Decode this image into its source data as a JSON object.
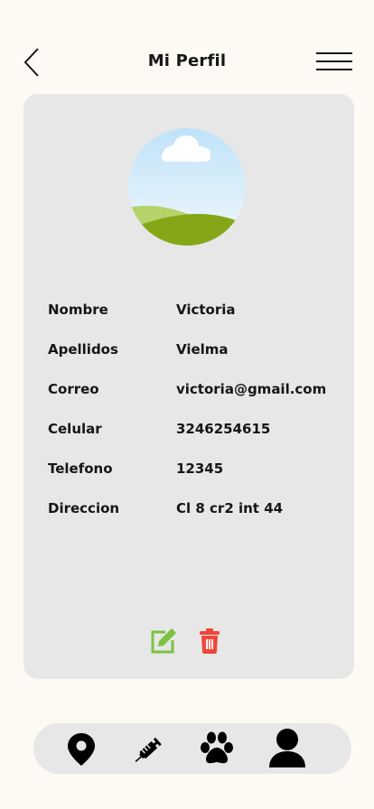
{
  "header": {
    "title": "Mi Perfil",
    "back_icon": "chevron-left-icon",
    "menu_icon": "hamburger-menu-icon"
  },
  "profile": {
    "avatar_icon": "landscape-avatar-icon",
    "fields": [
      {
        "label": "Nombre",
        "value": "Victoria"
      },
      {
        "label": "Apellidos",
        "value": "Vielma"
      },
      {
        "label": "Correo",
        "value": "victoria@gmail.com"
      },
      {
        "label": "Celular",
        "value": "3246254615"
      },
      {
        "label": "Telefono",
        "value": "12345"
      },
      {
        "label": "Direccion",
        "value": "Cl 8 cr2 int 44"
      }
    ]
  },
  "actions": {
    "edit_icon": "edit-icon",
    "delete_icon": "trash-icon",
    "edit_color": "#7cc243",
    "delete_color": "#f0463a"
  },
  "bottom_nav": {
    "items": [
      {
        "icon": "location-pin-icon"
      },
      {
        "icon": "syringe-icon"
      },
      {
        "icon": "paw-icon"
      },
      {
        "icon": "user-icon"
      }
    ]
  },
  "colors": {
    "background": "#fdf9f3",
    "card": "#e7e7e7",
    "text": "#161616"
  }
}
